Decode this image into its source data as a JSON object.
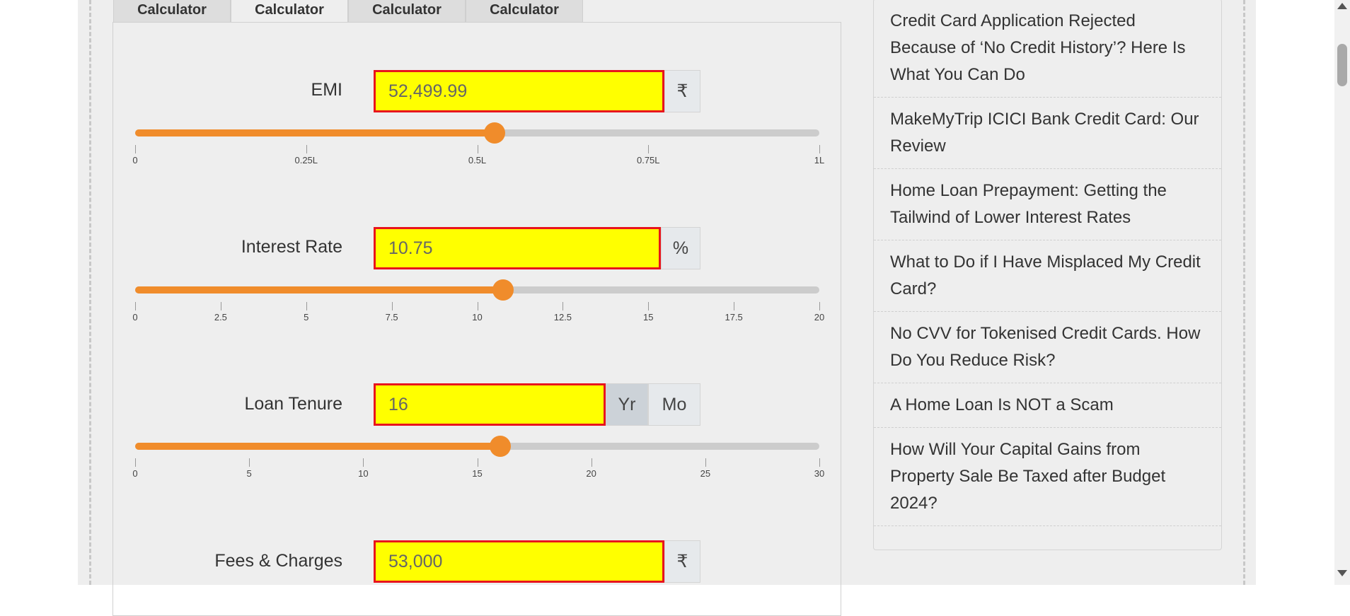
{
  "tabs": [
    "Calculator",
    "Calculator",
    "Calculator",
    "Calculator"
  ],
  "active_tab": 1,
  "emi": {
    "label": "EMI",
    "value": "52,499.99",
    "unit": "₹",
    "slider_fraction": 0.525,
    "ticks": [
      "0",
      "0.25L",
      "0.5L",
      "0.75L",
      "1L"
    ]
  },
  "interest": {
    "label": "Interest Rate",
    "value": "10.75",
    "unit": "%",
    "slider_fraction": 0.5375,
    "ticks": [
      "0",
      "2.5",
      "5",
      "7.5",
      "10",
      "12.5",
      "15",
      "17.5",
      "20"
    ]
  },
  "tenure": {
    "label": "Loan Tenure",
    "value": "16",
    "unit_year": "Yr",
    "unit_month": "Mo",
    "slider_fraction": 0.5333,
    "ticks": [
      "0",
      "5",
      "10",
      "15",
      "20",
      "25",
      "30"
    ]
  },
  "fees": {
    "label": "Fees & Charges",
    "value": "53,000",
    "unit": "₹"
  },
  "sidebar": {
    "items": [
      "Credit Card Application Rejected Because of ‘No Credit History’? Here Is What You Can Do",
      "MakeMyTrip ICICI Bank Credit Card: Our Review",
      "Home Loan Prepayment: Getting the Tailwind of Lower Interest Rates",
      "What to Do if I Have Misplaced My Credit Card?",
      "No CVV for Tokenised Credit Cards. How Do You Reduce Risk?",
      "A Home Loan Is NOT a Scam",
      "How Will Your Capital Gains from Property Sale Be Taxed after Budget 2024?"
    ]
  },
  "colors": {
    "accent": "#f08c2b",
    "field_bg": "#ffff00",
    "field_border": "#e8141d"
  },
  "icons": {
    "scroll_up": "triangle-up-icon",
    "scroll_down": "triangle-down-icon"
  }
}
